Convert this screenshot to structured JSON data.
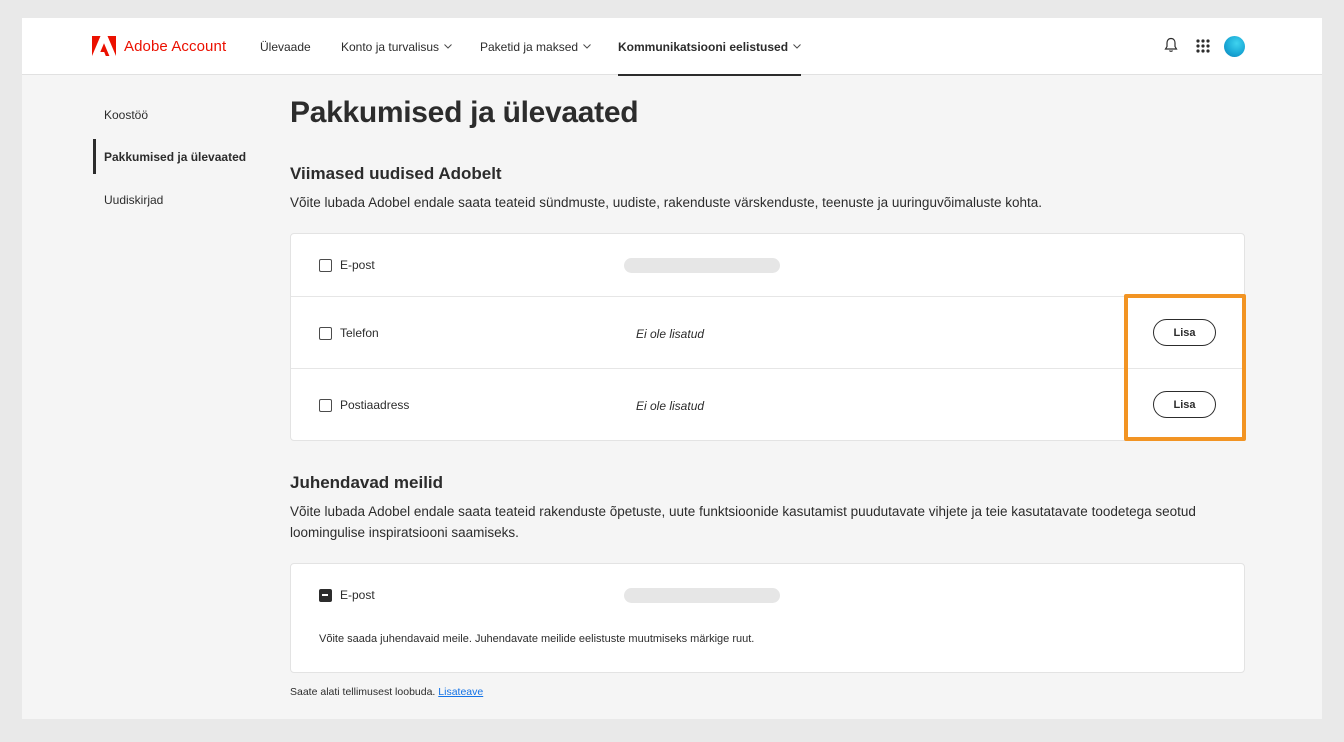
{
  "header": {
    "brand": "Adobe Account",
    "nav": [
      {
        "label": "Ülevaade"
      },
      {
        "label": "Konto ja turvalisus"
      },
      {
        "label": "Paketid ja maksed"
      },
      {
        "label": "Kommunikatsiooni eelistused"
      }
    ]
  },
  "sidebar": {
    "items": [
      {
        "label": "Koostöö"
      },
      {
        "label": "Pakkumised ja ülevaated"
      },
      {
        "label": "Uudiskirjad"
      }
    ]
  },
  "main": {
    "title": "Pakkumised ja ülevaated",
    "section1": {
      "title": "Viimased uudised Adobelt",
      "description": "Võite lubada Adobel endale saata teateid sündmuste, uudiste, rakenduste värskenduste, teenuste ja uuringuvõimaluste kohta.",
      "rows": [
        {
          "label": "E-post",
          "value": ""
        },
        {
          "label": "Telefon",
          "value": "Ei ole lisatud",
          "button": "Lisa"
        },
        {
          "label": "Postiaadress",
          "value": "Ei ole lisatud",
          "button": "Lisa"
        }
      ]
    },
    "section2": {
      "title": "Juhendavad meilid",
      "description": "Võite lubada Adobel endale saata teateid rakenduste õpetuste, uute funktsioonide kasutamist puudutavate vihjete ja teie kasutatavate toodetega seotud loomingulise inspiratsiooni saamiseks.",
      "row": {
        "label": "E-post"
      },
      "note": "Võite saada juhendavaid meile. Juhendavate meilide eelistuste muutmiseks märkige ruut."
    },
    "footer": {
      "text": "Saate alati tellimusest loobuda.",
      "link": "Lisateave"
    }
  },
  "colors": {
    "brand": "#eb1000",
    "highlight": "#f29423",
    "link": "#1473e6"
  }
}
